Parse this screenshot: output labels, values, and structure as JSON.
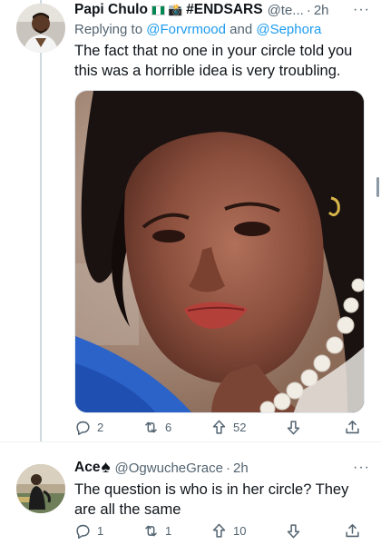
{
  "tweet1": {
    "display_name": "Papi Chulo",
    "handle_name": "#ENDSARS",
    "handle": "@te...",
    "separator": "·",
    "time": "2h",
    "more": "···",
    "flag_colors": [
      "#008751",
      "#ffffff",
      "#008751"
    ],
    "reply_prefix": "Replying to ",
    "reply_user1": "@Forvrmood",
    "reply_and": " and ",
    "reply_user2": "@Sephora",
    "text": "The fact that no one in your circle told you this was a horrible idea is very troubling.",
    "actions": {
      "replies": "2",
      "retweets": "6",
      "likes": "52"
    }
  },
  "tweet2": {
    "display_name": "Ace",
    "handle": "@OgwucheGrace",
    "separator": "·",
    "time": "2h",
    "more": "···",
    "text": "The question is who is in her circle? They are all the same",
    "actions": {
      "replies": "1",
      "retweets": "1",
      "likes": "10"
    }
  },
  "colors": {
    "accent": "#1d9bf0",
    "secondary_text": "#536471",
    "thread_line": "#cfd9de"
  },
  "icons": [
    "reply-icon",
    "retweet-icon",
    "like-icon",
    "downvote-icon",
    "share-icon",
    "more-icon",
    "nigeria-flag-icon",
    "camera-icon",
    "spade-icon"
  ]
}
